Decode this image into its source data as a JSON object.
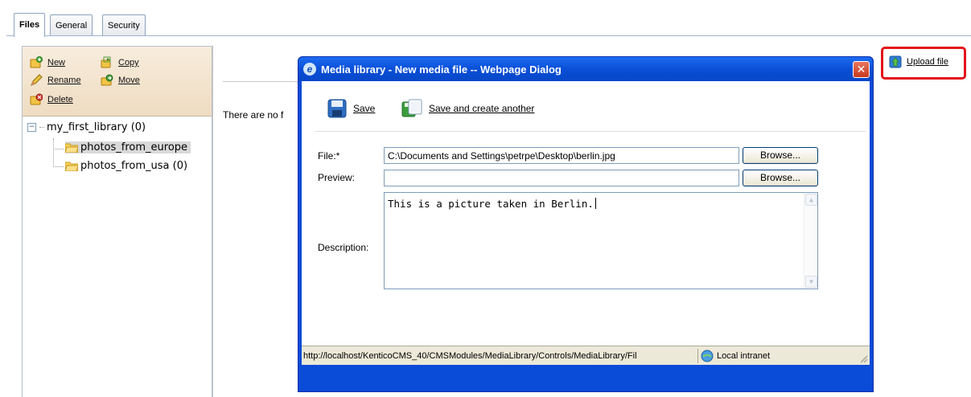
{
  "tabs": [
    {
      "label": "Files",
      "active": true
    },
    {
      "label": "General",
      "active": false
    },
    {
      "label": "Security",
      "active": false
    }
  ],
  "actions": {
    "new": "New",
    "copy": "Copy",
    "rename": "Rename",
    "move": "Move",
    "delete": "Delete"
  },
  "tree": {
    "root": "my_first_library (0)",
    "children": [
      "photos_from_europe",
      "photos_from_usa (0)"
    ]
  },
  "content": {
    "no_files_text": "There are no f"
  },
  "upload": {
    "label": "Upload file",
    "highlight_color": "#e3141a"
  },
  "dialog": {
    "title": "Media library - New media file -- Webpage Dialog",
    "close_glyph": "✕",
    "save_label": "Save",
    "save_another_label": "Save and create another",
    "file_label": "File:*",
    "file_value": "C:\\Documents and Settings\\petrpe\\Desktop\\berlin.jpg",
    "browse_label": "Browse...",
    "preview_label": "Preview:",
    "preview_value": "",
    "preview_browse_label": "Browse...",
    "description_label": "Description:",
    "description_value": "This is a picture taken in Berlin.",
    "status_url": "http://localhost/KenticoCMS_40/CMSModules/MediaLibrary/Controls/MediaLibrary/Fil",
    "status_zone": "Local intranet"
  },
  "colors": {
    "dialog_frame": "#0a4bd8",
    "action_panel": "#f3e4cf"
  }
}
